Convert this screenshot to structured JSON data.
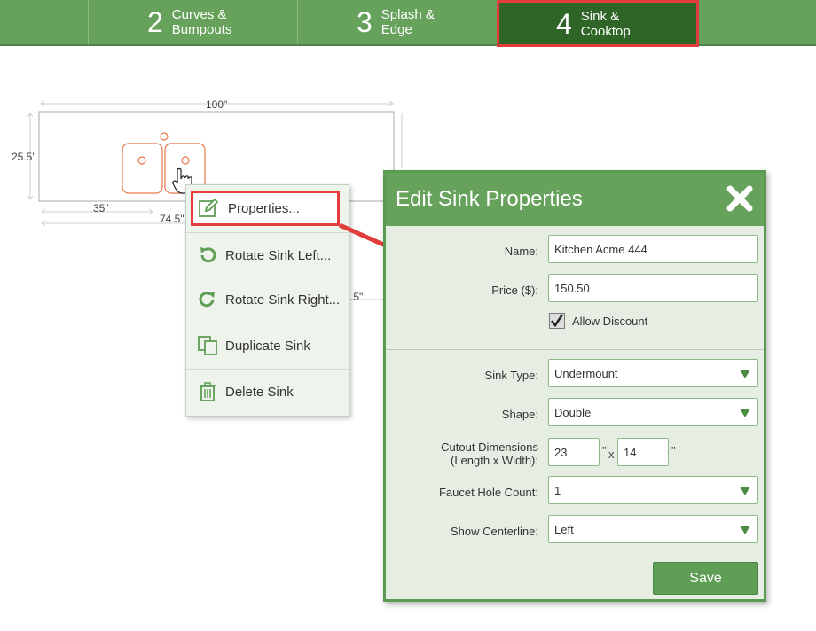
{
  "steps": [
    {
      "number": "2",
      "label": "Curves &\nBumpouts"
    },
    {
      "number": "3",
      "label": "Splash &\nEdge"
    },
    {
      "number": "4",
      "label": "Sink &\nCooktop"
    }
  ],
  "drawing": {
    "dims": {
      "width": "100\"",
      "depth": "25.5\"",
      "left_offset": "35\"",
      "center_offset": "74.5\"",
      "partial": ".5\""
    }
  },
  "context_menu": {
    "items": [
      {
        "label": "Properties...",
        "icon": "pencil-icon"
      },
      {
        "label": "Rotate Sink Left...",
        "icon": "rotate-left-icon"
      },
      {
        "label": "Rotate Sink Right...",
        "icon": "rotate-right-icon"
      },
      {
        "label": "Duplicate Sink",
        "icon": "duplicate-icon"
      },
      {
        "label": "Delete Sink",
        "icon": "trash-icon"
      }
    ]
  },
  "dialog": {
    "title": "Edit Sink Properties",
    "name_label": "Name:",
    "name_value": "Kitchen Acme 444",
    "price_label": "Price ($):",
    "price_value": "150.50",
    "allow_discount_label": "Allow Discount",
    "allow_discount_checked": true,
    "sink_type_label": "Sink Type:",
    "sink_type_value": "Undermount",
    "shape_label": "Shape:",
    "shape_value": "Double",
    "cutout_label_line1": "Cutout Dimensions",
    "cutout_label_line2": "(Length x Width):",
    "cutout_length": "23",
    "cutout_width": "14",
    "inch_mark": "\"",
    "x_mark": "x",
    "faucet_label": "Faucet Hole Count:",
    "faucet_value": "1",
    "centerline_label": "Show Centerline:",
    "centerline_value": "Left",
    "save_label": "Save"
  },
  "colors": {
    "brand_green": "#66a25c",
    "dark_green": "#2f6627",
    "highlight_red": "#e23c3c",
    "sink_orange": "#e8794a"
  }
}
